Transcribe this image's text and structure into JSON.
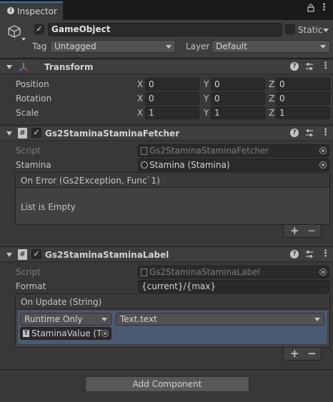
{
  "tab": {
    "label": "Inspector",
    "icon": "info-icon"
  },
  "header": {
    "active_checked": true,
    "name": "GameObject",
    "static_label": "Static",
    "static_checked": false,
    "tag_label": "Tag",
    "tag_value": "Untagged",
    "layer_label": "Layer",
    "layer_value": "Default"
  },
  "transform": {
    "title": "Transform",
    "rows": [
      {
        "label": "Position",
        "x": "0",
        "y": "0",
        "z": "0"
      },
      {
        "label": "Rotation",
        "x": "0",
        "y": "0",
        "z": "0"
      },
      {
        "label": "Scale",
        "x": "1",
        "y": "1",
        "z": "1"
      }
    ],
    "axes": [
      "X",
      "Y",
      "Z"
    ]
  },
  "fetcher": {
    "title": "Gs2StaminaStaminaFetcher",
    "enabled": true,
    "script_label": "Script",
    "script_value": "Gs2StaminaStaminaFetcher",
    "stamina_label": "Stamina",
    "stamina_value": "Stamina (Stamina)",
    "event_title": "On Error (Gs2Exception, Func`1)",
    "event_empty": "List is Empty"
  },
  "label_comp": {
    "title": "Gs2StaminaStaminaLabel",
    "enabled": true,
    "script_label": "Script",
    "script_value": "Gs2StaminaStaminaLabel",
    "format_label": "Format",
    "format_value": "{current}/{max}",
    "event_title": "On Update (String)",
    "runtime_value": "Runtime Only",
    "function_value": "Text.text",
    "target_value": "StaminaValue (T"
  },
  "plus": "+",
  "minus": "−",
  "add_component": "Add Component",
  "colors": {
    "tab_accent": "#3d6fb0",
    "panel": "#383838",
    "header": "#3e3e3e"
  }
}
